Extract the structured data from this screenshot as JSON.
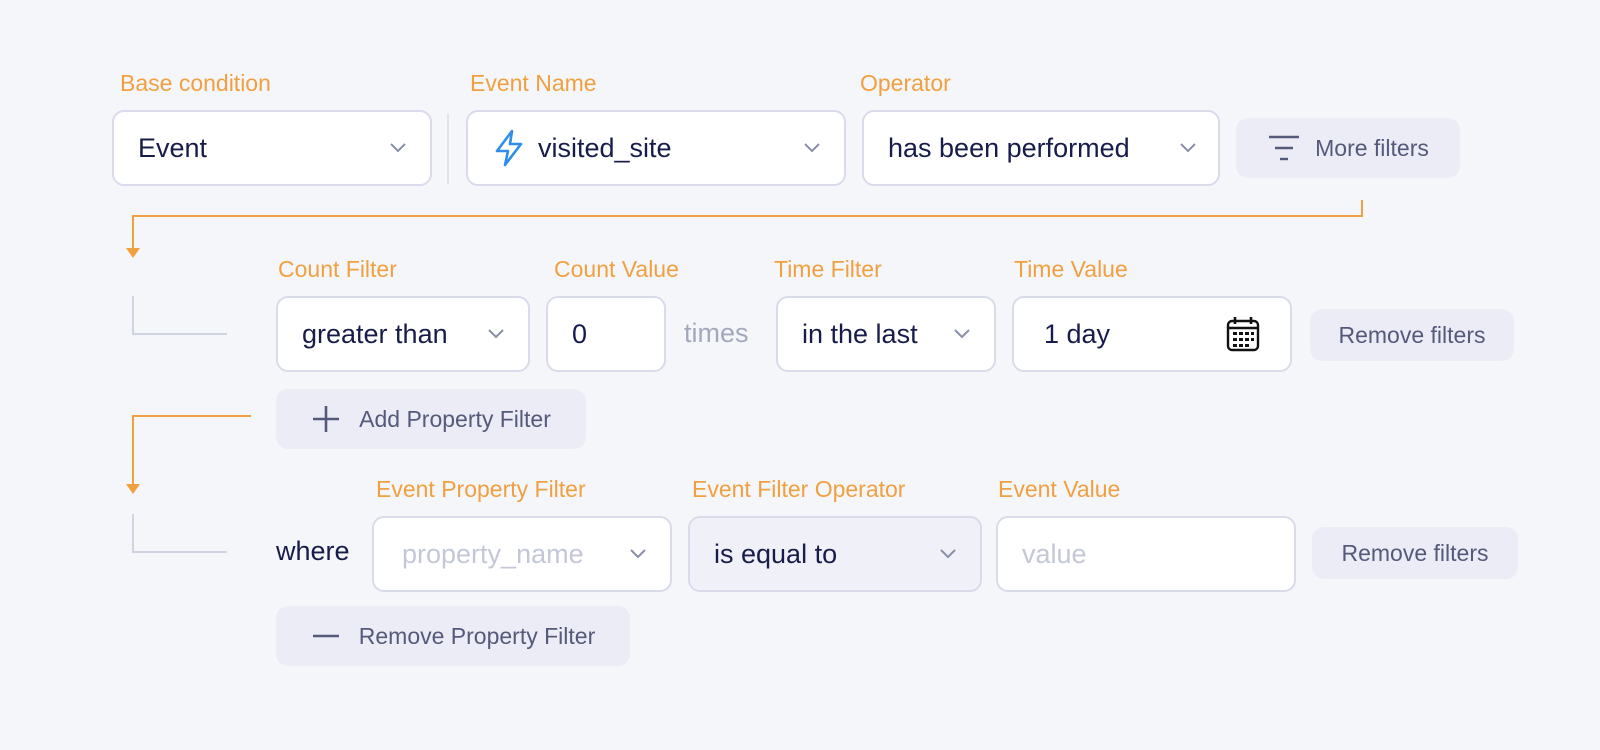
{
  "base_condition": {
    "label": "Base condition",
    "value": "Event"
  },
  "event_name": {
    "label": "Event Name",
    "value": "visited_site",
    "icon": "lightning-icon"
  },
  "operator": {
    "label": "Operator",
    "value": "has been performed"
  },
  "more_filters": {
    "label": "More filters",
    "icon": "filter-icon"
  },
  "count_filter": {
    "label": "Count Filter",
    "value": "greater than"
  },
  "count_value": {
    "label": "Count Value",
    "value": "0",
    "suffix": "times"
  },
  "time_filter": {
    "label": "Time Filter",
    "value": "in the last"
  },
  "time_value": {
    "label": "Time Value",
    "value": "1 day",
    "icon": "calendar-icon"
  },
  "remove_filters_1": {
    "label": "Remove filters"
  },
  "add_property_filter": {
    "label": "Add Property Filter",
    "icon": "plus-icon"
  },
  "where_label": "where",
  "event_property_filter": {
    "label": "Event Property Filter",
    "placeholder": "property_name"
  },
  "event_filter_operator": {
    "label": "Event Filter Operator",
    "value": "is equal to"
  },
  "event_value": {
    "label": "Event Value",
    "placeholder": "value"
  },
  "remove_filters_2": {
    "label": "Remove filters"
  },
  "remove_property_filter": {
    "label": "Remove Property Filter",
    "icon": "minus-icon"
  },
  "colors": {
    "accent": "#f0a040",
    "text": "#171c4a",
    "border": "#d9dbea",
    "icon_blue": "#2f8fe8",
    "connector": "#d0d3e2"
  }
}
